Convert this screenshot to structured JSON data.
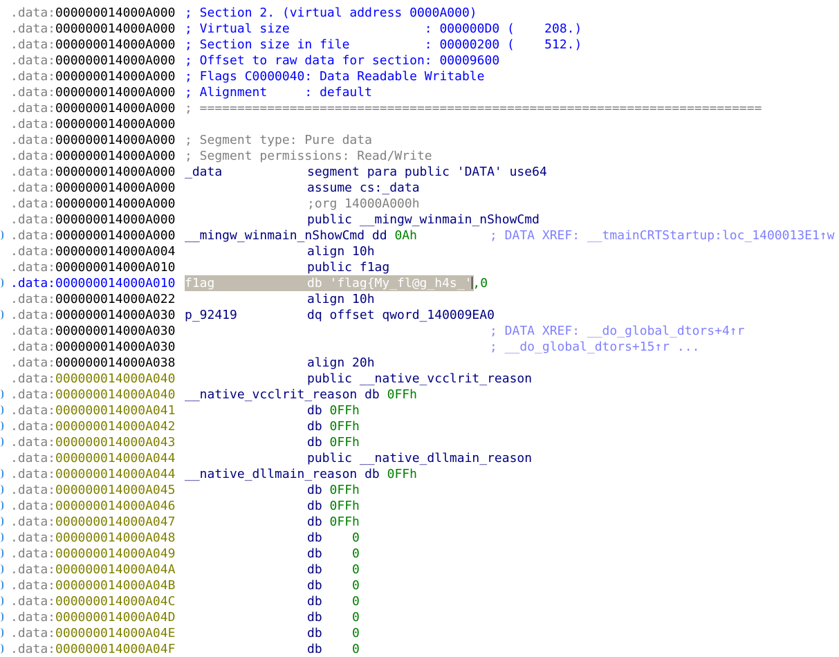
{
  "segment_prefix": ".data:",
  "lines": [
    {
      "addr": "000000014000A000",
      "addr_style": "gray",
      "c1": "; Section 2. (virtual address 0000A000)",
      "c1_style": "blue"
    },
    {
      "addr": "000000014000A000",
      "addr_style": "gray",
      "c1": "; Virtual size                  : 000000D0 (    208.)",
      "c1_style": "blue"
    },
    {
      "addr": "000000014000A000",
      "addr_style": "gray",
      "c1": "; Section size in file          : 00000200 (    512.)",
      "c1_style": "blue"
    },
    {
      "addr": "000000014000A000",
      "addr_style": "gray",
      "c1": "; Offset to raw data for section: 00009600",
      "c1_style": "blue"
    },
    {
      "addr": "000000014000A000",
      "addr_style": "gray",
      "c1": "; Flags C0000040: Data Readable Writable",
      "c1_style": "blue"
    },
    {
      "addr": "000000014000A000",
      "addr_style": "gray",
      "c1": "; Alignment     : default",
      "c1_style": "blue"
    },
    {
      "addr": "000000014000A000",
      "addr_style": "gray",
      "c1": "; ===========================================================================",
      "c1_style": "gray"
    },
    {
      "addr": "000000014000A000",
      "addr_style": "gray"
    },
    {
      "addr": "000000014000A000",
      "addr_style": "gray",
      "c1": "; Segment type: Pure data",
      "c1_style": "gray"
    },
    {
      "addr": "000000014000A000",
      "addr_style": "gray",
      "c1": "; Segment permissions: Read/Write",
      "c1_style": "gray"
    },
    {
      "addr": "000000014000A000",
      "addr_style": "gray",
      "c1": "_data",
      "c1_style": "navy",
      "c2": "segment para public 'DATA' use64",
      "c2_style": "navy"
    },
    {
      "addr": "000000014000A000",
      "addr_style": "gray",
      "c2": "assume cs:_data",
      "c2_style": "navy"
    },
    {
      "addr": "000000014000A000",
      "addr_style": "gray",
      "c2": ";org 14000A000h",
      "c2_style": "gray"
    },
    {
      "addr": "000000014000A000",
      "addr_style": "gray",
      "c2": "public __mingw_winmain_nShowCmd",
      "c2_style": "navy"
    },
    {
      "addr": "000000014000A000",
      "addr_style": "gray",
      "marker": true,
      "c1": "__mingw_winmain_nShowCmd dd ",
      "c1_style": "navy",
      "c1_value": "0Ah",
      "c3": "; DATA XREF: __tmainCRTStartup:loc_1400013E1↑w",
      "c3_style": "xref"
    },
    {
      "addr": "000000014000A004",
      "addr_style": "gray",
      "c2": "align 10h",
      "c2_style": "navy",
      "c2_value": ""
    },
    {
      "addr": "000000014000A010",
      "addr_style": "gray",
      "c2": "public f1ag",
      "c2_style": "navy"
    },
    {
      "addr": "000000014000A010",
      "addr_style": "cur",
      "marker": true,
      "highlight": true,
      "c1": "f1ag",
      "c2": "db 'flag{My_fl@g_h4s_'",
      "c2_tail": ",0"
    },
    {
      "addr": "000000014000A022",
      "addr_style": "gray",
      "c2": "align 10h",
      "c2_style": "navy"
    },
    {
      "addr": "000000014000A030",
      "addr_style": "gray",
      "marker": true,
      "c1": "p_92419",
      "c1_style": "navy",
      "c2": "dq offset qword_140009EA0",
      "c2_style": "navy"
    },
    {
      "addr": "000000014000A030",
      "addr_style": "gray",
      "c3": "; DATA XREF: __do_global_dtors+4↑r",
      "c3_style": "xref"
    },
    {
      "addr": "000000014000A030",
      "addr_style": "gray",
      "c3": "; __do_global_dtors+15↑r ...",
      "c3_style": "xref"
    },
    {
      "addr": "000000014000A038",
      "addr_style": "gray",
      "c2": "align 20h",
      "c2_style": "navy"
    },
    {
      "addr": "000000014000A040",
      "addr_style": "olive",
      "c2": "public __native_vcclrit_reason",
      "c2_style": "navy"
    },
    {
      "addr": "000000014000A040",
      "addr_style": "olive",
      "marker": true,
      "c1": "__native_vcclrit_reason db ",
      "c1_style": "navy",
      "c1_value": "0FFh"
    },
    {
      "addr": "000000014000A041",
      "addr_style": "olive",
      "marker": true,
      "c2": "db ",
      "c2_style": "navy",
      "c2_value": "0FFh"
    },
    {
      "addr": "000000014000A042",
      "addr_style": "olive",
      "marker": true,
      "c2": "db ",
      "c2_style": "navy",
      "c2_value": "0FFh"
    },
    {
      "addr": "000000014000A043",
      "addr_style": "olive",
      "marker": true,
      "c2": "db ",
      "c2_style": "navy",
      "c2_value": "0FFh"
    },
    {
      "addr": "000000014000A044",
      "addr_style": "olive",
      "c2": "public __native_dllmain_reason",
      "c2_style": "navy"
    },
    {
      "addr": "000000014000A044",
      "addr_style": "olive",
      "marker": true,
      "c1": "__native_dllmain_reason db ",
      "c1_style": "navy",
      "c1_value": "0FFh"
    },
    {
      "addr": "000000014000A045",
      "addr_style": "olive",
      "marker": true,
      "c2": "db ",
      "c2_style": "navy",
      "c2_value": "0FFh"
    },
    {
      "addr": "000000014000A046",
      "addr_style": "olive",
      "marker": true,
      "c2": "db ",
      "c2_style": "navy",
      "c2_value": "0FFh"
    },
    {
      "addr": "000000014000A047",
      "addr_style": "olive",
      "marker": true,
      "c2": "db ",
      "c2_style": "navy",
      "c2_value": "0FFh"
    },
    {
      "addr": "000000014000A048",
      "addr_style": "olive",
      "marker": true,
      "c2": "db    ",
      "c2_style": "navy",
      "c2_value": "0"
    },
    {
      "addr": "000000014000A049",
      "addr_style": "olive",
      "marker": true,
      "c2": "db    ",
      "c2_style": "navy",
      "c2_value": "0"
    },
    {
      "addr": "000000014000A04A",
      "addr_style": "olive",
      "marker": true,
      "c2": "db    ",
      "c2_style": "navy",
      "c2_value": "0"
    },
    {
      "addr": "000000014000A04B",
      "addr_style": "olive",
      "marker": true,
      "c2": "db    ",
      "c2_style": "navy",
      "c2_value": "0"
    },
    {
      "addr": "000000014000A04C",
      "addr_style": "olive",
      "marker": true,
      "c2": "db    ",
      "c2_style": "navy",
      "c2_value": "0"
    },
    {
      "addr": "000000014000A04D",
      "addr_style": "olive",
      "marker": true,
      "c2": "db    ",
      "c2_style": "navy",
      "c2_value": "0"
    },
    {
      "addr": "000000014000A04E",
      "addr_style": "olive",
      "marker": true,
      "c2": "db    ",
      "c2_style": "navy",
      "c2_value": "0"
    },
    {
      "addr": "000000014000A04F",
      "addr_style": "olive",
      "marker": true,
      "c2": "db    ",
      "c2_style": "navy",
      "c2_value": "0"
    }
  ]
}
